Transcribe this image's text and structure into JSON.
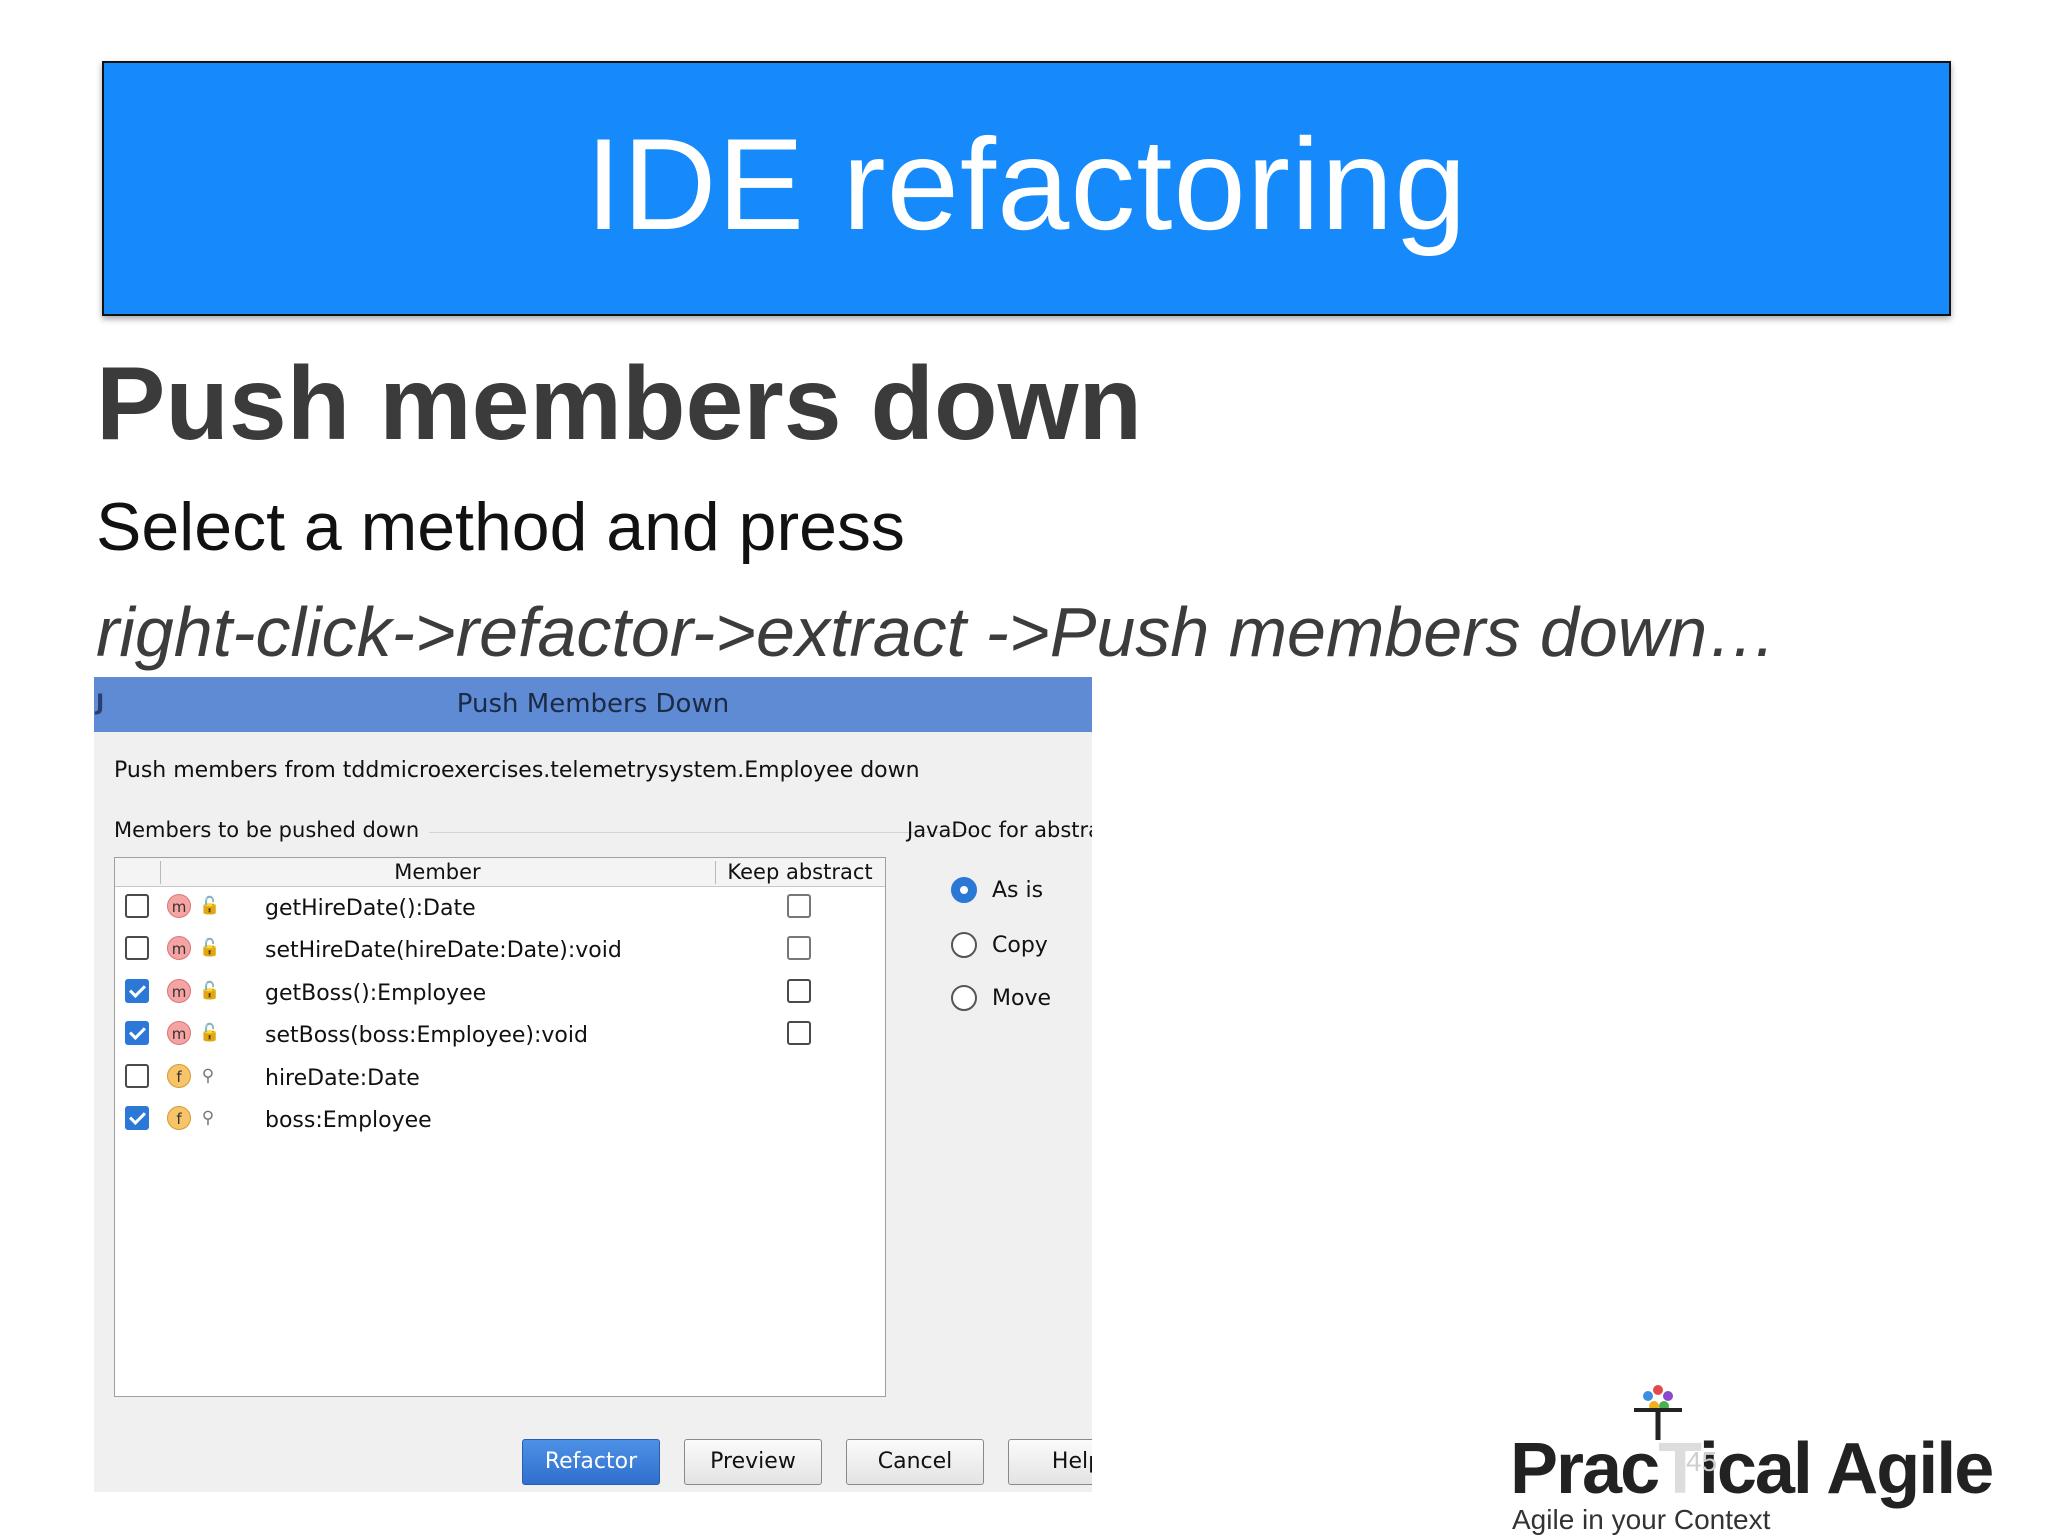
{
  "slide": {
    "title": "IDE refactoring",
    "heading": "Push members down",
    "instruction": "Select a method and press",
    "menu_path": "right-click->refactor->extract ->Push members down…",
    "page_number": "45"
  },
  "dialog": {
    "title": "Push Members Down",
    "subtitle": "Push members from tddmicroexercises.telemetrysystem.Employee down",
    "members_section_label": "Members to be pushed down",
    "javadoc_label": "JavaDoc for abstrac",
    "columns": {
      "member": "Member",
      "keep_abstract": "Keep abstract"
    },
    "members": [
      {
        "name": "getHireDate():Date",
        "kind": "m",
        "visibility": "public",
        "checked": false,
        "keep_abstract": false
      },
      {
        "name": "setHireDate(hireDate:Date):void",
        "kind": "m",
        "visibility": "public",
        "checked": false,
        "keep_abstract": false
      },
      {
        "name": "getBoss():Employee",
        "kind": "m",
        "visibility": "public",
        "checked": true,
        "keep_abstract": false
      },
      {
        "name": "setBoss(boss:Employee):void",
        "kind": "m",
        "visibility": "public",
        "checked": true,
        "keep_abstract": false
      },
      {
        "name": "hireDate:Date",
        "kind": "f",
        "visibility": "private",
        "checked": false
      },
      {
        "name": "boss:Employee",
        "kind": "f",
        "visibility": "private",
        "checked": true
      }
    ],
    "javadoc_options": [
      {
        "label": "As is",
        "selected": true
      },
      {
        "label": "Copy",
        "selected": false
      },
      {
        "label": "Move",
        "selected": false
      }
    ],
    "buttons": {
      "refactor": "Refactor",
      "preview": "Preview",
      "cancel": "Cancel",
      "help": "Help"
    }
  },
  "logo": {
    "name": "PracTicalAgile",
    "tagline": "Agile in your Context"
  },
  "colors": {
    "banner": "#168afb",
    "titlebar": "#5f8bd4",
    "accent": "#2b78d6"
  }
}
